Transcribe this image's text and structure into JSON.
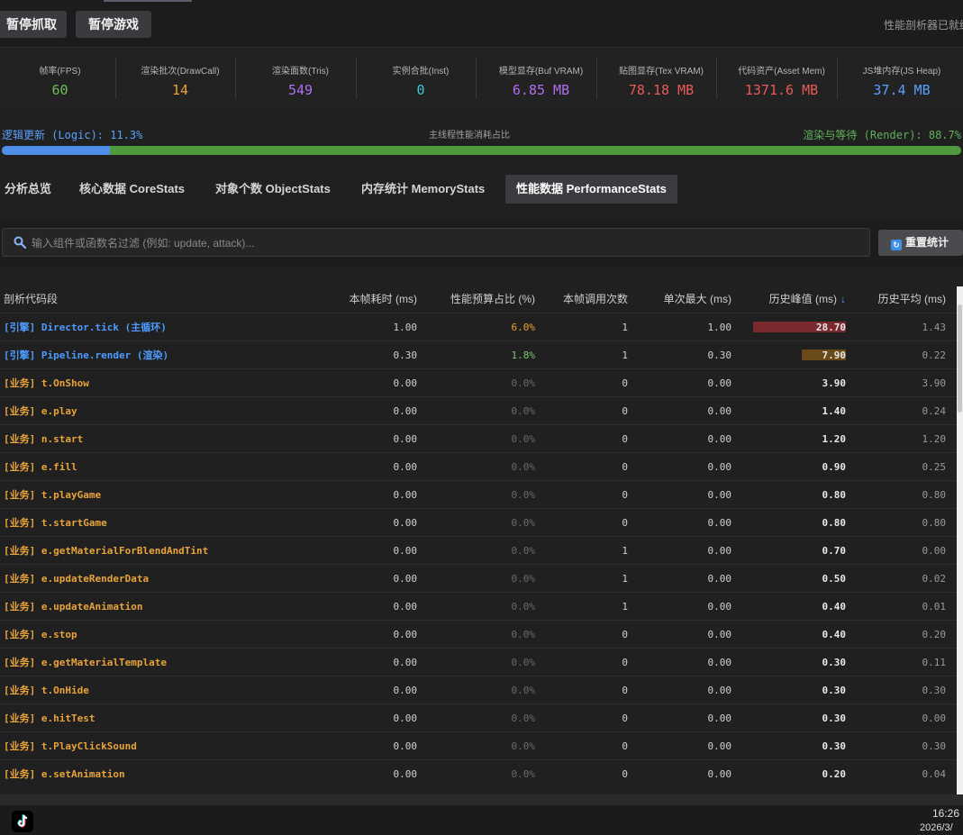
{
  "toolbar": {
    "pause_capture": "暂停抓取",
    "pause_game": "暂停游戏",
    "status": "性能剖析器已就绪"
  },
  "stats": [
    {
      "label": "帧率(FPS)",
      "value": "60",
      "color": "#6cbf5a"
    },
    {
      "label": "渲染批次(DrawCall)",
      "value": "14",
      "color": "#f0a030"
    },
    {
      "label": "渲染面数(Tris)",
      "value": "549",
      "color": "#b070f0"
    },
    {
      "label": "实例合批(Inst)",
      "value": "0",
      "color": "#3fc8d8"
    },
    {
      "label": "模型显存(Buf VRAM)",
      "value": "6.85 MB",
      "color": "#b070f0"
    },
    {
      "label": "贴图显存(Tex VRAM)",
      "value": "78.18 MB",
      "color": "#e85a5a"
    },
    {
      "label": "代码资产(Asset Mem)",
      "value": "1371.6 MB",
      "color": "#e85a5a"
    },
    {
      "label": "JS堆内存(JS Heap)",
      "value": "37.4 MB",
      "color": "#5aa0ff"
    }
  ],
  "thread": {
    "logic_label": "逻辑更新 (Logic): 11.3%",
    "logic_percent": 11.3,
    "main_label": "主线程性能消耗占比",
    "render_label": "渲染与等待 (Render): 88.7%",
    "logic_color": "#4f8ee8",
    "render_color": "#4f9a3e"
  },
  "tabs": [
    {
      "label": "分析总览"
    },
    {
      "label": "核心数据 CoreStats"
    },
    {
      "label": "对象个数 ObjectStats"
    },
    {
      "label": "内存统计 MemoryStats"
    },
    {
      "label": "性能数据 PerformanceStats",
      "active": true
    }
  ],
  "filter": {
    "placeholder": "输入组件或函数名过滤 (例如: update, attack)...",
    "value": "",
    "reset_label": "重置统计"
  },
  "table": {
    "columns": [
      "剖析代码段",
      "本帧耗时 (ms)",
      "性能预算占比 (%)",
      "本帧调用次数",
      "单次最大 (ms)",
      "历史峰值 (ms)",
      "历史平均 (ms)"
    ],
    "sort_indicator": "↓",
    "rows": [
      {
        "name": "[引擎] Director.tick (主循环)",
        "kind": "engine",
        "time": "1.00",
        "pct": "6.0%",
        "pct_level": "warn",
        "calls": "1",
        "max": "1.00",
        "peak": "28.70",
        "peak_level": 1.0,
        "peak_color": "#7a2a2e",
        "avg": "1.43"
      },
      {
        "name": "[引擎] Pipeline.render (渲染)",
        "kind": "engine",
        "time": "0.30",
        "pct": "1.8%",
        "pct_level": "ok",
        "calls": "1",
        "max": "0.30",
        "peak": "7.90",
        "peak_level": 0.48,
        "peak_color": "#6a4a1a",
        "avg": "0.22"
      },
      {
        "name": "[业务] t.OnShow",
        "kind": "biz",
        "time": "0.00",
        "pct": "0.0%",
        "pct_level": "dim",
        "calls": "0",
        "max": "0.00",
        "peak": "3.90",
        "avg": "3.90"
      },
      {
        "name": "[业务] e.play",
        "kind": "biz",
        "time": "0.00",
        "pct": "0.0%",
        "pct_level": "dim",
        "calls": "0",
        "max": "0.00",
        "peak": "1.40",
        "avg": "0.24"
      },
      {
        "name": "[业务] n.start",
        "kind": "biz",
        "time": "0.00",
        "pct": "0.0%",
        "pct_level": "dim",
        "calls": "0",
        "max": "0.00",
        "peak": "1.20",
        "avg": "1.20"
      },
      {
        "name": "[业务] e.fill",
        "kind": "biz",
        "time": "0.00",
        "pct": "0.0%",
        "pct_level": "dim",
        "calls": "0",
        "max": "0.00",
        "peak": "0.90",
        "avg": "0.25"
      },
      {
        "name": "[业务] t.playGame",
        "kind": "biz",
        "time": "0.00",
        "pct": "0.0%",
        "pct_level": "dim",
        "calls": "0",
        "max": "0.00",
        "peak": "0.80",
        "avg": "0.80"
      },
      {
        "name": "[业务] t.startGame",
        "kind": "biz",
        "time": "0.00",
        "pct": "0.0%",
        "pct_level": "dim",
        "calls": "0",
        "max": "0.00",
        "peak": "0.80",
        "avg": "0.80"
      },
      {
        "name": "[业务] e.getMaterialForBlendAndTint",
        "kind": "biz",
        "time": "0.00",
        "pct": "0.0%",
        "pct_level": "dim",
        "calls": "1",
        "max": "0.00",
        "peak": "0.70",
        "avg": "0.00"
      },
      {
        "name": "[业务] e.updateRenderData",
        "kind": "biz",
        "time": "0.00",
        "pct": "0.0%",
        "pct_level": "dim",
        "calls": "1",
        "max": "0.00",
        "peak": "0.50",
        "avg": "0.02"
      },
      {
        "name": "[业务] e.updateAnimation",
        "kind": "biz",
        "time": "0.00",
        "pct": "0.0%",
        "pct_level": "dim",
        "calls": "1",
        "max": "0.00",
        "peak": "0.40",
        "avg": "0.01"
      },
      {
        "name": "[业务] e.stop",
        "kind": "biz",
        "time": "0.00",
        "pct": "0.0%",
        "pct_level": "dim",
        "calls": "0",
        "max": "0.00",
        "peak": "0.40",
        "avg": "0.20"
      },
      {
        "name": "[业务] e.getMaterialTemplate",
        "kind": "biz",
        "time": "0.00",
        "pct": "0.0%",
        "pct_level": "dim",
        "calls": "0",
        "max": "0.00",
        "peak": "0.30",
        "avg": "0.11"
      },
      {
        "name": "[业务] t.OnHide",
        "kind": "biz",
        "time": "0.00",
        "pct": "0.0%",
        "pct_level": "dim",
        "calls": "0",
        "max": "0.00",
        "peak": "0.30",
        "avg": "0.30"
      },
      {
        "name": "[业务] e.hitTest",
        "kind": "biz",
        "time": "0.00",
        "pct": "0.0%",
        "pct_level": "dim",
        "calls": "0",
        "max": "0.00",
        "peak": "0.30",
        "avg": "0.00"
      },
      {
        "name": "[业务] t.PlayClickSound",
        "kind": "biz",
        "time": "0.00",
        "pct": "0.0%",
        "pct_level": "dim",
        "calls": "0",
        "max": "0.00",
        "peak": "0.30",
        "avg": "0.30"
      },
      {
        "name": "[业务] e.setAnimation",
        "kind": "biz",
        "time": "0.00",
        "pct": "0.0%",
        "pct_level": "dim",
        "calls": "0",
        "max": "0.00",
        "peak": "0.20",
        "avg": "0.04"
      }
    ]
  },
  "taskbar": {
    "app_icon": "tiktok-icon",
    "time": "16:26",
    "date": "2026/3/"
  }
}
